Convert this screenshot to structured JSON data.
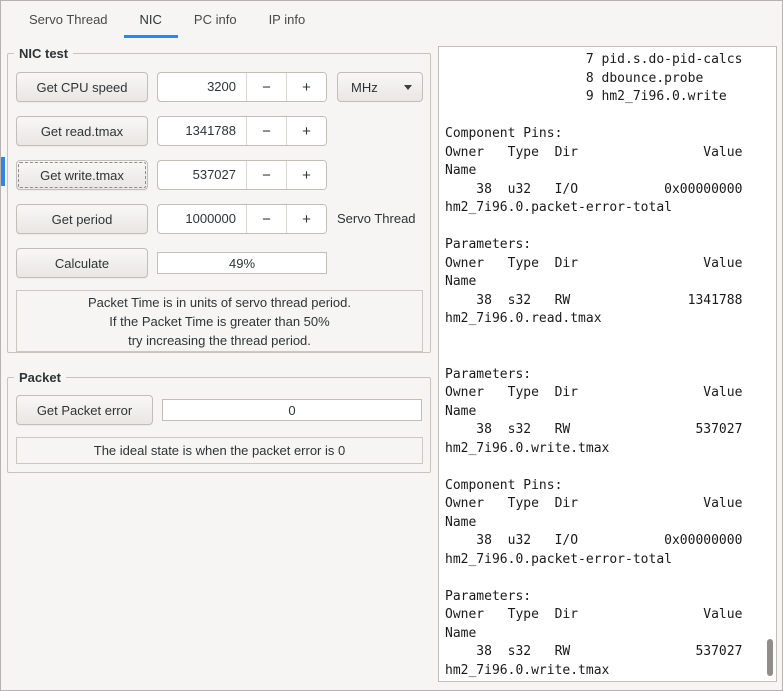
{
  "colors": {
    "accent": "#3584e4",
    "window_bg": "#f6f5f4"
  },
  "tabs": {
    "items": [
      {
        "label": "Servo Thread"
      },
      {
        "label": "NIC"
      },
      {
        "label": "PC info"
      },
      {
        "label": "IP info"
      }
    ],
    "active_label": "NIC"
  },
  "icons": {
    "minus": "−",
    "plus": "+"
  },
  "nic_test": {
    "title": "NIC test",
    "cpu_speed": {
      "button_label": "Get CPU speed",
      "value": "3200",
      "unit": "MHz"
    },
    "read_tmax": {
      "button_label": "Get read.tmax",
      "value": "1341788"
    },
    "write_tmax": {
      "button_label": "Get write.tmax",
      "value": "537027"
    },
    "period": {
      "button_label": "Get period",
      "value": "1000000",
      "thread_label": "Servo Thread"
    },
    "calculate": {
      "button_label": "Calculate",
      "progress_text": "49%"
    },
    "note_lines": [
      "Packet Time is in units of servo thread period.",
      "If the Packet Time is greater than 50%",
      "try increasing the thread period."
    ]
  },
  "packet": {
    "title": "Packet",
    "button_label": "Get Packet error",
    "error_value": "0",
    "note": "The ideal state is when the packet error is 0"
  },
  "hal_output": {
    "lines": [
      "                  7 pid.s.do-pid-calcs",
      "                  8 dbounce.probe",
      "                  9 hm2_7i96.0.write",
      "",
      "Component Pins:",
      "Owner   Type  Dir                Value",
      "Name",
      "    38  u32   I/O           0x00000000",
      "hm2_7i96.0.packet-error-total",
      "",
      "Parameters:",
      "Owner   Type  Dir                Value",
      "Name",
      "    38  s32   RW               1341788",
      "hm2_7i96.0.read.tmax",
      "",
      "",
      "Parameters:",
      "Owner   Type  Dir                Value",
      "Name",
      "    38  s32   RW                537027",
      "hm2_7i96.0.write.tmax",
      "",
      "Component Pins:",
      "Owner   Type  Dir                Value",
      "Name",
      "    38  u32   I/O           0x00000000",
      "hm2_7i96.0.packet-error-total",
      "",
      "Parameters:",
      "Owner   Type  Dir                Value",
      "Name",
      "    38  s32   RW                537027",
      "hm2_7i96.0.write.tmax"
    ]
  }
}
